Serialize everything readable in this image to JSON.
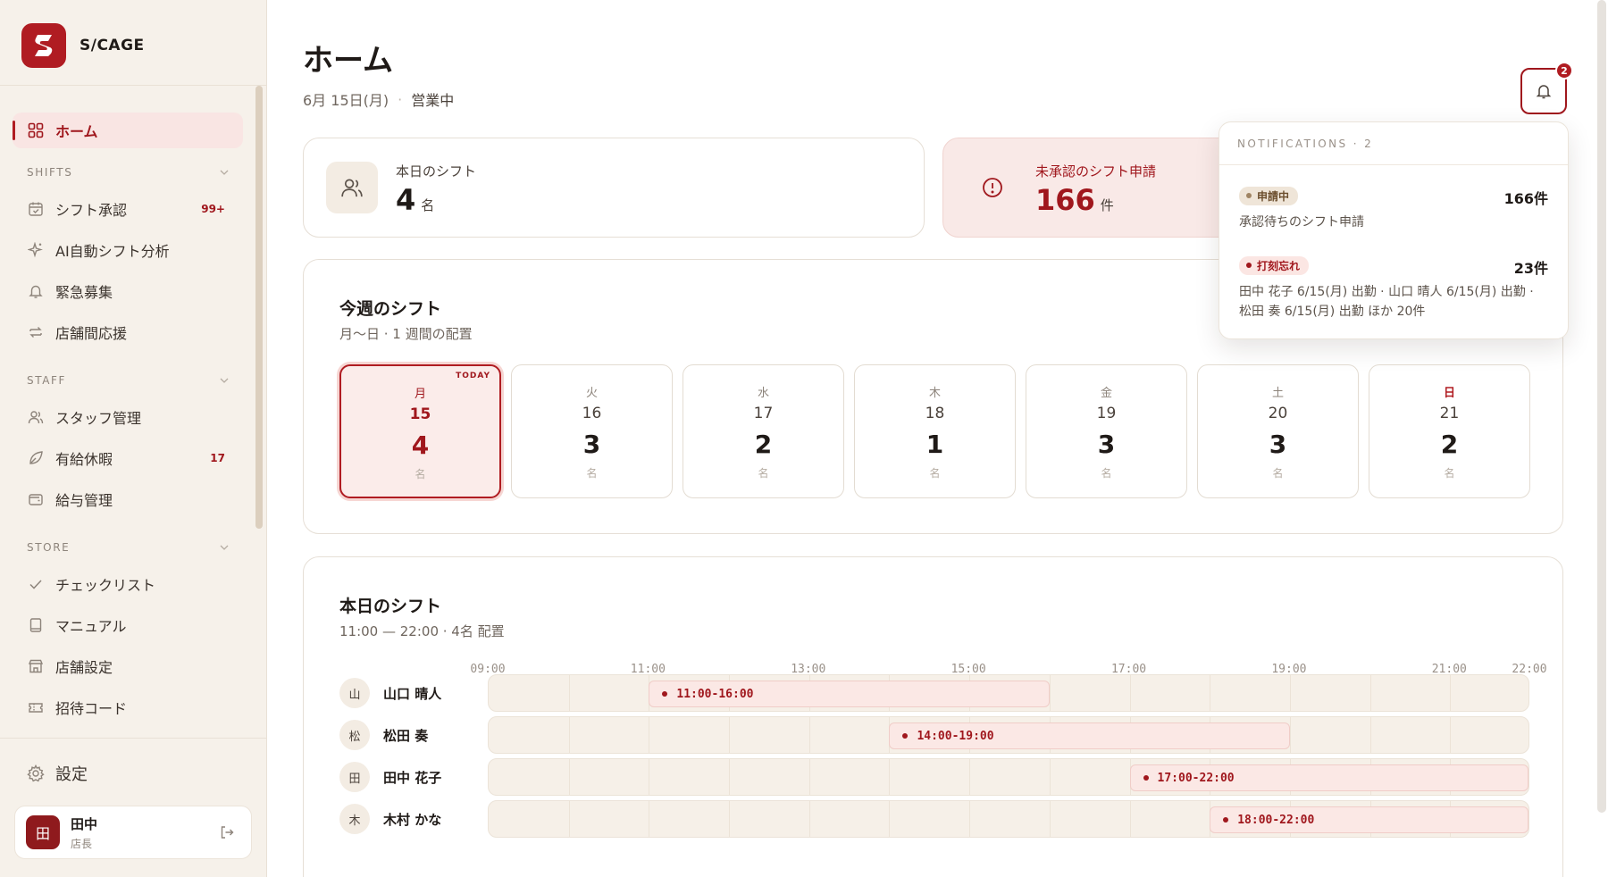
{
  "brand": {
    "name": "S/CAGE"
  },
  "sidebar": {
    "home": "ホーム",
    "sections": {
      "shifts": "SHIFTS",
      "staff": "STAFF",
      "store": "STORE"
    },
    "shifts_items": [
      {
        "label": "シフト承認",
        "badge": "99+"
      },
      {
        "label": "AI自動シフト分析"
      },
      {
        "label": "緊急募集"
      },
      {
        "label": "店舗間応援"
      }
    ],
    "staff_items": [
      {
        "label": "スタッフ管理"
      },
      {
        "label": "有給休暇",
        "badge": "17"
      },
      {
        "label": "給与管理"
      }
    ],
    "store_items": [
      {
        "label": "チェックリスト"
      },
      {
        "label": "マニュアル"
      },
      {
        "label": "店舗設定"
      },
      {
        "label": "招待コード"
      }
    ],
    "settings": "設定",
    "user": {
      "avatar": "田",
      "name": "田中",
      "role": "店長"
    }
  },
  "header": {
    "title": "ホーム",
    "date": "6月 15日(月)",
    "separator": "·",
    "status": "営業中",
    "notification_count": "2"
  },
  "stats": {
    "today_shift": {
      "label": "本日のシフト",
      "value": "4",
      "unit": "名"
    },
    "pending": {
      "label": "未承認のシフト申請",
      "value": "166",
      "unit": "件"
    }
  },
  "week": {
    "title": "今週のシフト",
    "subtitle": "月〜日 · 1 週間の配置",
    "today_tag": "TODAY",
    "days": [
      {
        "dow": "月",
        "date": "15",
        "count": "4",
        "unit": "名"
      },
      {
        "dow": "火",
        "date": "16",
        "count": "3",
        "unit": "名"
      },
      {
        "dow": "水",
        "date": "17",
        "count": "2",
        "unit": "名"
      },
      {
        "dow": "木",
        "date": "18",
        "count": "1",
        "unit": "名"
      },
      {
        "dow": "金",
        "date": "19",
        "count": "3",
        "unit": "名"
      },
      {
        "dow": "土",
        "date": "20",
        "count": "3",
        "unit": "名"
      },
      {
        "dow": "日",
        "date": "21",
        "count": "2",
        "unit": "名"
      }
    ]
  },
  "today": {
    "title": "本日のシフト",
    "subtitle": "11:00 — 22:00 · 4名 配置",
    "timeline_start_hour": 9,
    "timeline_end_hour": 22,
    "time_labels": [
      "09:00",
      "11:00",
      "13:00",
      "15:00",
      "17:00",
      "19:00",
      "21:00",
      "22:00"
    ],
    "rows": [
      {
        "avatar": "山",
        "name": "山口 晴人",
        "shift": "11:00-16:00",
        "start": 11,
        "end": 16
      },
      {
        "avatar": "松",
        "name": "松田 奏",
        "shift": "14:00-19:00",
        "start": 14,
        "end": 19
      },
      {
        "avatar": "田",
        "name": "田中 花子",
        "shift": "17:00-22:00",
        "start": 17,
        "end": 22
      },
      {
        "avatar": "木",
        "name": "木村 かな",
        "shift": "18:00-22:00",
        "start": 18,
        "end": 22
      }
    ]
  },
  "notifications": {
    "heading": "NOTIFICATIONS · 2",
    "items": [
      {
        "tag": "申請中",
        "count": "166件",
        "desc": "承認待ちのシフト申請"
      },
      {
        "tag": "打刻忘れ",
        "count": "23件",
        "desc": "田中 花子 6/15(月) 出勤 · 山口 晴人 6/15(月) 出勤 · 松田 奏 6/15(月) 出勤 ほか 20件"
      }
    ]
  },
  "colors": {
    "accent": "#b01c22",
    "accent_dark": "#a0171d",
    "sidebar_bg": "#f6f1ea",
    "track_bg": "#f6f0e8"
  }
}
